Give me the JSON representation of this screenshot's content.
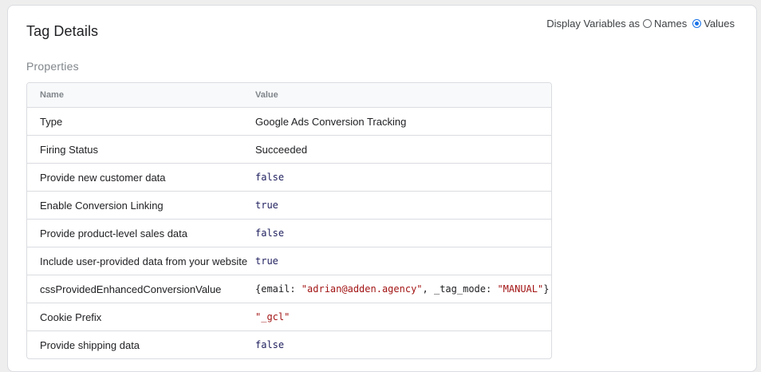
{
  "panel": {
    "title": "Tag Details",
    "display_variables": {
      "label": "Display Variables as",
      "options": [
        "Names",
        "Values"
      ],
      "selected": "Values"
    },
    "section_title": "Properties"
  },
  "table": {
    "headers": {
      "name": "Name",
      "value": "Value"
    },
    "rows": [
      {
        "name": "Type",
        "value": "Google Ads Conversion Tracking"
      },
      {
        "name": "Firing Status",
        "value": "Succeeded"
      },
      {
        "name": "Provide new customer data",
        "value": "false"
      },
      {
        "name": "Enable Conversion Linking",
        "value": "true"
      },
      {
        "name": "Provide product-level sales data",
        "value": "false"
      },
      {
        "name": "Include user-provided data from your website",
        "value": "true"
      },
      {
        "name": "cssProvidedEnhancedConversionValue",
        "value_parts": {
          "open": "{email: ",
          "email": "\"adrian@adden.agency\"",
          "mid": ", _tag_mode: ",
          "mode": "\"MANUAL\"",
          "close": "}"
        }
      },
      {
        "name": "Cookie Prefix",
        "value": "\"_gcl\""
      },
      {
        "name": "Provide shipping data",
        "value": "false"
      }
    ]
  },
  "colors": {
    "accent": "#1a73e8",
    "string": "#a31515",
    "keyword": "#1f1f5f",
    "border": "#dadce0"
  }
}
